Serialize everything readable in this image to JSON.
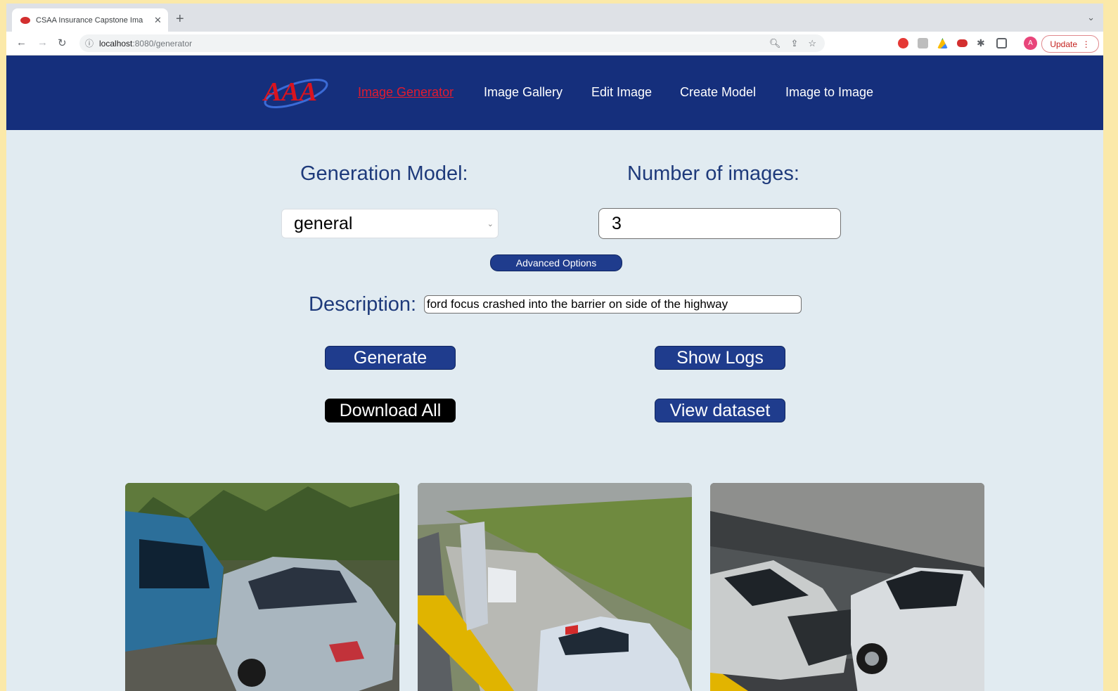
{
  "browser": {
    "tab_title": "CSAA Insurance Capstone Ima",
    "url_host": "localhost",
    "url_path": ":8080/generator",
    "update_label": "Update",
    "avatar_letter": "A"
  },
  "nav": {
    "items": [
      {
        "label": "Image Generator",
        "active": true
      },
      {
        "label": "Image Gallery",
        "active": false
      },
      {
        "label": "Edit Image",
        "active": false
      },
      {
        "label": "Create Model",
        "active": false
      },
      {
        "label": "Image to Image",
        "active": false
      }
    ],
    "colors": {
      "bar": "#152f7c",
      "active": "#e11b2f"
    }
  },
  "form": {
    "model_label": "Generation Model:",
    "model_value": "general",
    "count_label": "Number of images:",
    "count_value": "3",
    "advanced_label": "Advanced Options",
    "description_label": "Description:",
    "description_value": "ford focus crashed into the barrier on side of the highway"
  },
  "actions": {
    "generate": "Generate",
    "show_logs": "Show Logs",
    "download_all": "Download All",
    "view_dataset": "View dataset"
  },
  "results": {
    "count": 3,
    "images": [
      "generated crash image 1",
      "generated crash image 2",
      "generated crash image 3"
    ]
  }
}
